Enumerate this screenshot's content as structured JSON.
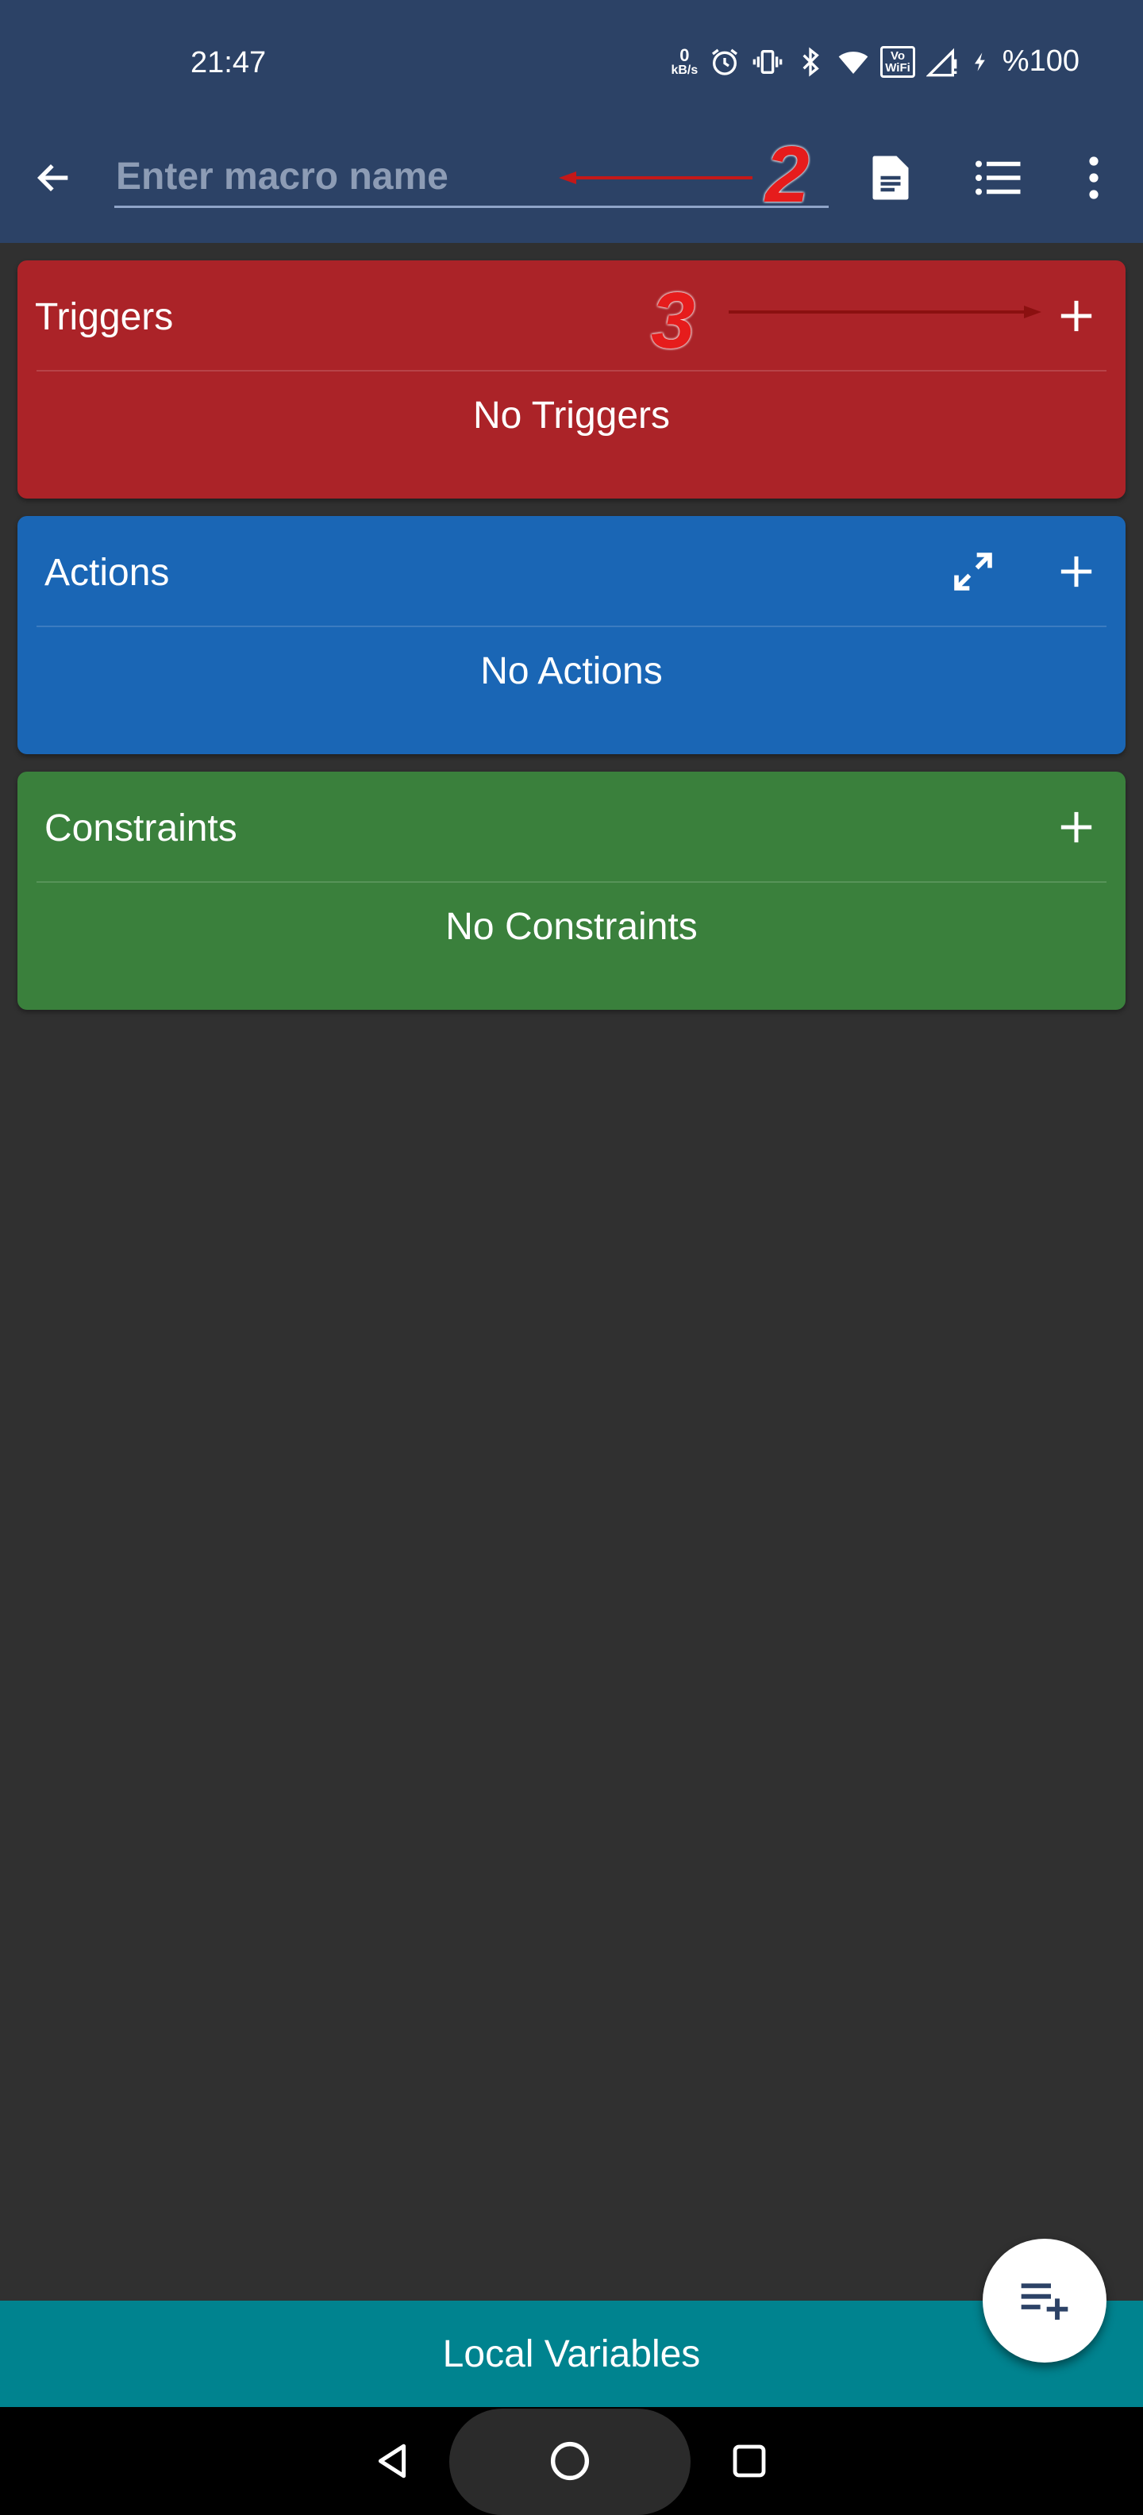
{
  "status_bar": {
    "time": "21:47",
    "net_speed_value": "0",
    "net_speed_unit": "kB/s",
    "vowifi_label_top": "Vo",
    "vowifi_label_bottom": "WiFi",
    "battery": "%100",
    "icons": [
      "alarm-icon",
      "vibrate-icon",
      "bluetooth-icon",
      "wifi-icon",
      "vowifi-icon",
      "signal-icon",
      "charging-icon"
    ]
  },
  "toolbar": {
    "name_placeholder": "Enter macro name",
    "name_value": "",
    "icons": [
      "back-arrow-icon",
      "document-icon",
      "list-icon",
      "more-vert-icon"
    ]
  },
  "annotations": {
    "name_marker": "2",
    "triggers_marker": "3",
    "color": "#e61c1c"
  },
  "sections": {
    "triggers": {
      "title": "Triggers",
      "empty_text": "No Triggers",
      "color": "#ab2328"
    },
    "actions": {
      "title": "Actions",
      "empty_text": "No Actions",
      "color": "#1a66b5"
    },
    "constraints": {
      "title": "Constraints",
      "empty_text": "No Constraints",
      "color": "#3a803c"
    }
  },
  "bottom": {
    "local_variables_label": "Local Variables",
    "local_variables_color": "#00838f",
    "fab_icon": "playlist-add-icon"
  },
  "navigation": {
    "icons": [
      "nav-back-icon",
      "nav-home-icon",
      "nav-recents-icon"
    ]
  }
}
